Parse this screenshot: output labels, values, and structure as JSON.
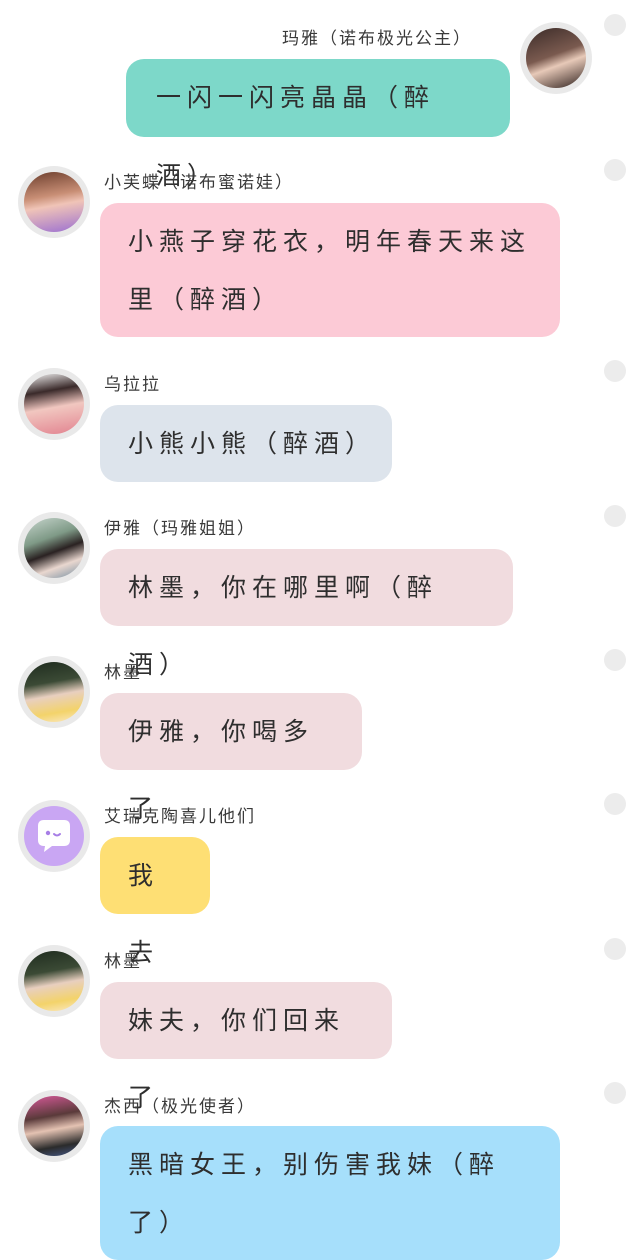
{
  "colors": {
    "mint": "#7dd8c9",
    "pink": "#fccad6",
    "slate": "#dde4ec",
    "rose": "#f1dcdf",
    "yellow": "#fedf74",
    "sky": "#a6dffb",
    "dot": "#ececec"
  },
  "messages": [
    {
      "name": "玛雅（诺布极光公主）",
      "text": "一闪一闪亮晶晶（醉酒）",
      "side": "right"
    },
    {
      "name": "小芙蝶（诺布蜜诺娃）",
      "line1": "小燕子穿花衣，明年春天来这",
      "line2": "里（醉酒）",
      "side": "left"
    },
    {
      "name": "乌拉拉",
      "text": "小熊小熊（醉酒）",
      "side": "left"
    },
    {
      "name": "伊雅（玛雅姐姐）",
      "text": "林墨，你在哪里啊（醉酒）",
      "side": "left"
    },
    {
      "name": "林墨",
      "text": "伊雅，你喝多了",
      "side": "left"
    },
    {
      "name": "艾瑞克陶喜儿他们",
      "text": "我去",
      "side": "left"
    },
    {
      "name": "林墨",
      "text": "妹夫，你们回来了",
      "side": "left"
    },
    {
      "name": "杰西（极光使者）",
      "line1": "黑暗女王，别伤害我妹（醉",
      "line2": "了）",
      "side": "left"
    }
  ]
}
